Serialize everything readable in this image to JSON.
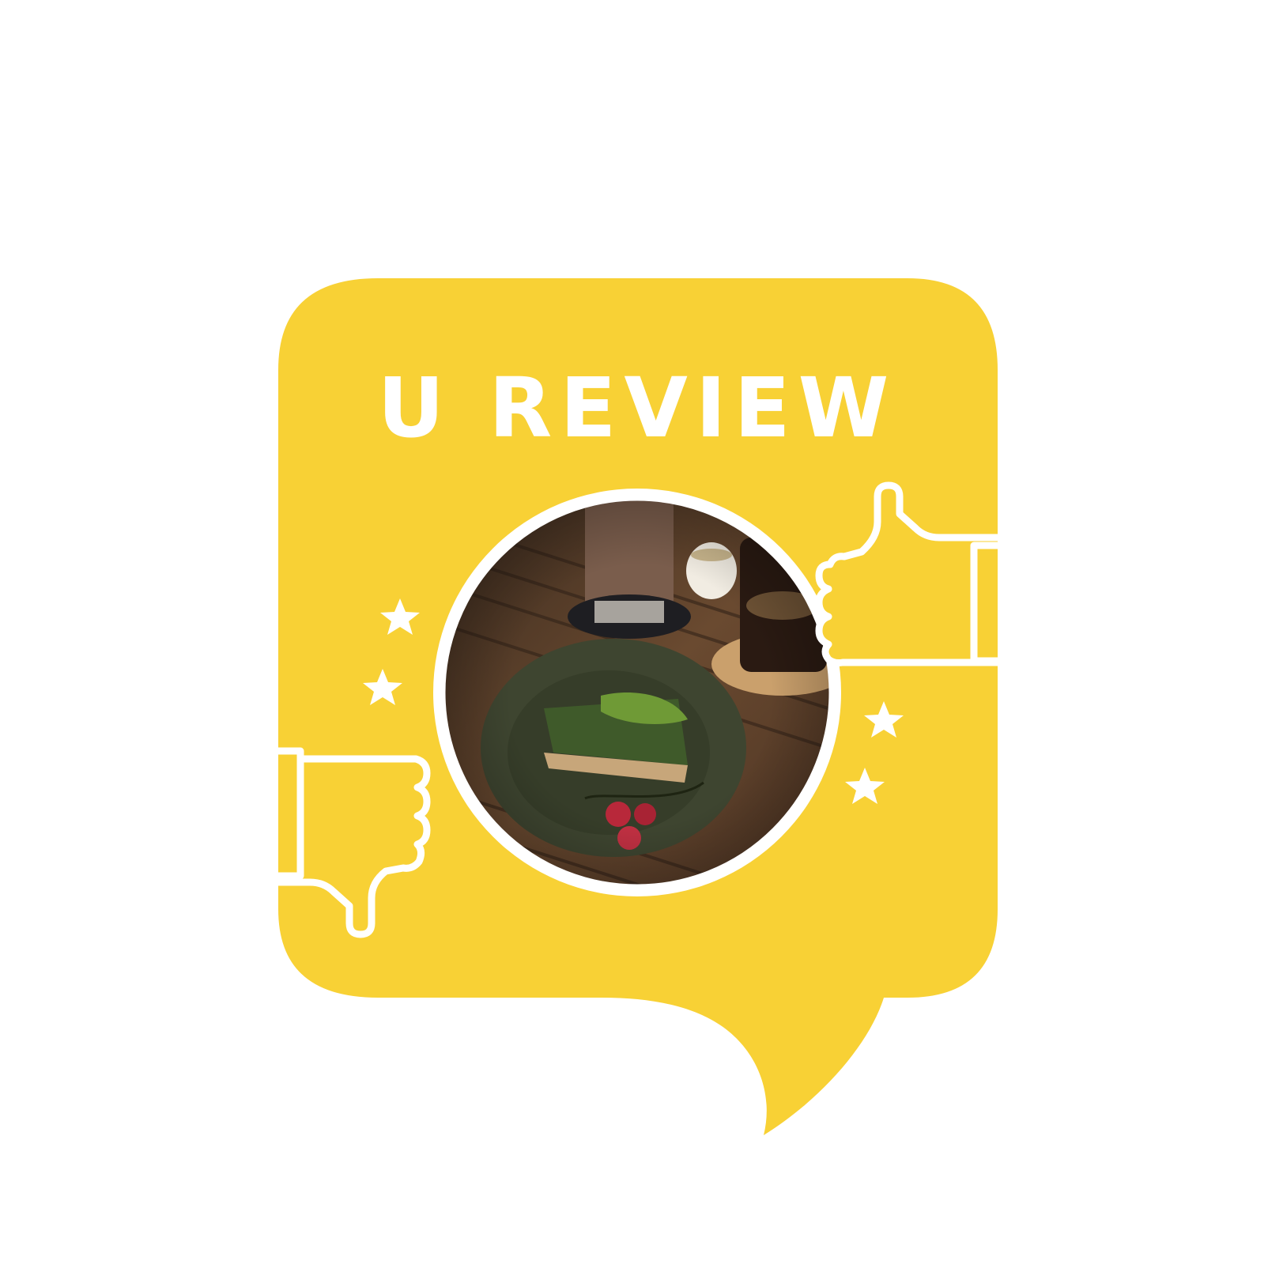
{
  "badge": {
    "title": "U REVIEW",
    "bubble_color": "#F8D135",
    "title_color": "#FFFFFF",
    "line_color": "#FFFFFF"
  },
  "photo": {
    "description_icon": "food-photo",
    "palette": {
      "table": "#5a3f28",
      "plate": "#3e4530",
      "cake": "#3f5a2a",
      "matcha": "#6f9a36",
      "berry": "#b8283a",
      "drink_milk": "#7a5d4c",
      "drink_dark": "#2a1a12"
    }
  },
  "icons": {
    "thumbs_up": "thumbs-up-icon",
    "thumbs_down": "thumbs-down-icon",
    "star": "star-icon"
  }
}
